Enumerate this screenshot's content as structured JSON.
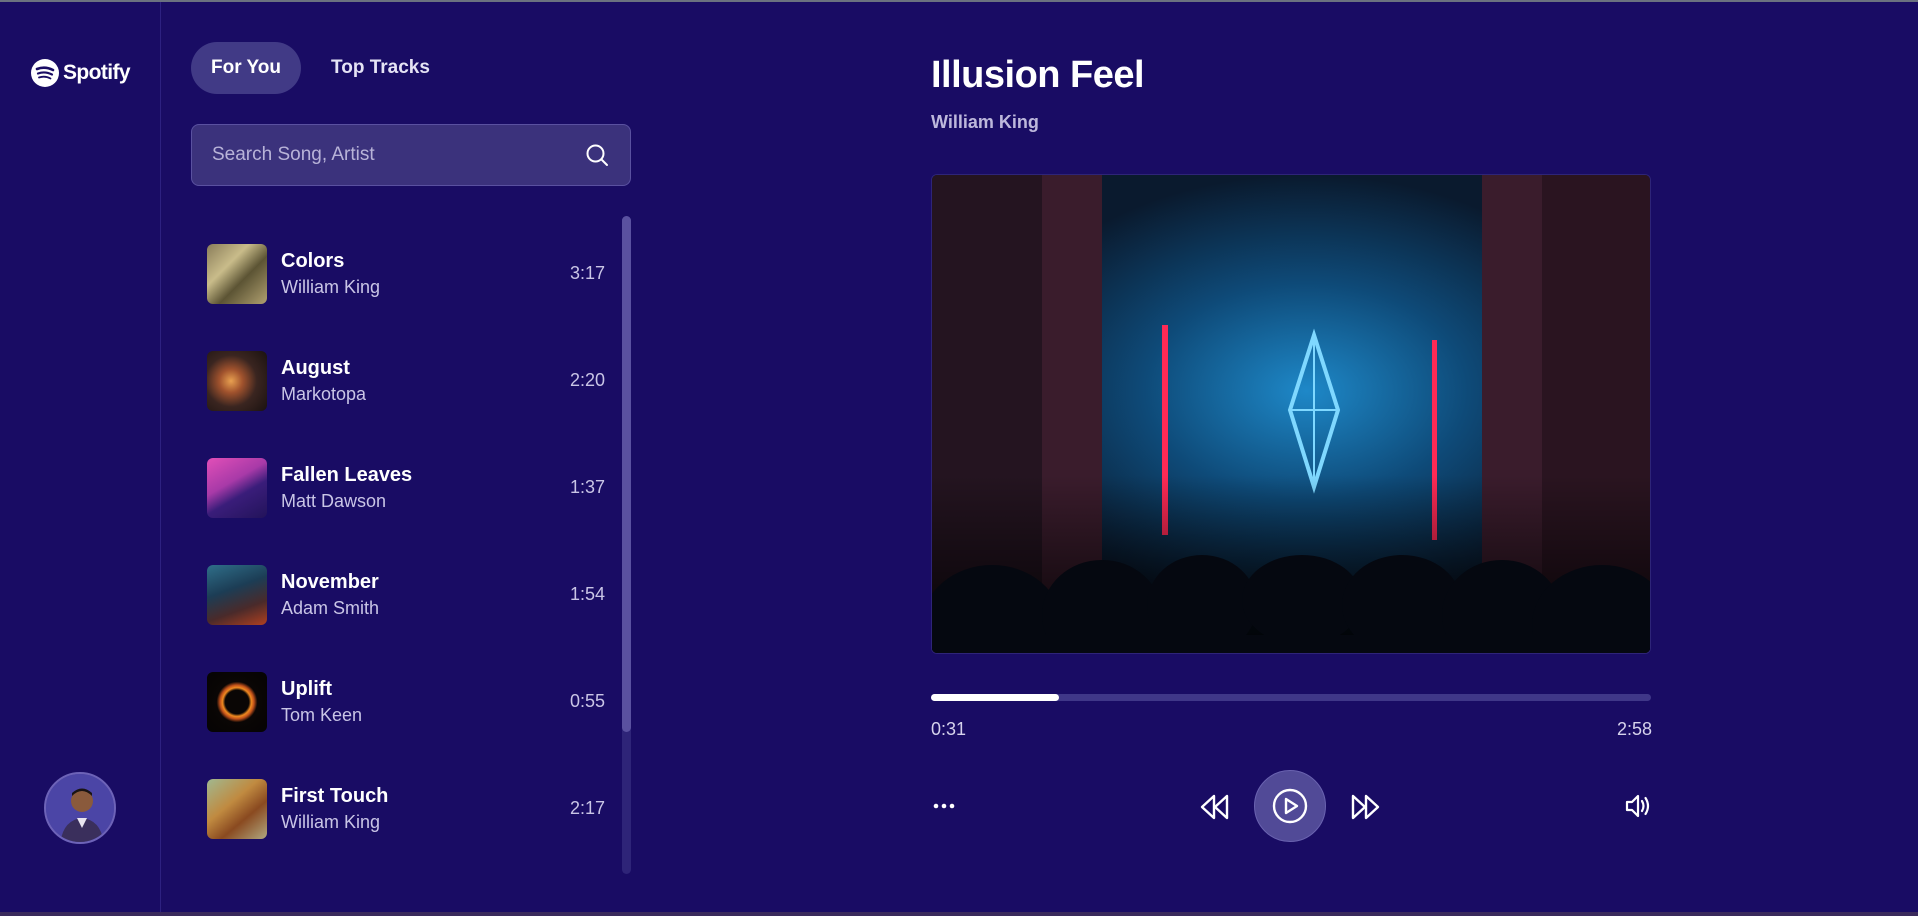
{
  "brand": {
    "name": "Spotify"
  },
  "tabs": [
    {
      "label": "For You",
      "active": true
    },
    {
      "label": "Top Tracks",
      "active": false
    }
  ],
  "search": {
    "placeholder": "Search Song, Artist",
    "value": ""
  },
  "tracks": [
    {
      "title": "Colors",
      "artist": "William King",
      "duration": "3:17"
    },
    {
      "title": "August",
      "artist": "Markotopa",
      "duration": "2:20"
    },
    {
      "title": "Fallen Leaves",
      "artist": "Matt Dawson",
      "duration": "1:37"
    },
    {
      "title": "November",
      "artist": "Adam Smith",
      "duration": "1:54"
    },
    {
      "title": "Uplift",
      "artist": "Tom Keen",
      "duration": "0:55"
    },
    {
      "title": "First Touch",
      "artist": "William King",
      "duration": "2:17"
    }
  ],
  "player": {
    "title": "Illusion Feel",
    "artist": "William King",
    "elapsed": "0:31",
    "total": "2:58",
    "progress": 0.178
  },
  "icons": {
    "logo": "spotify-logo-icon",
    "search": "search-icon",
    "more": "more-horizontal-icon",
    "rewind": "rewind-icon",
    "play": "play-icon",
    "forward": "fast-forward-icon",
    "volume": "volume-icon"
  },
  "colors": {
    "background": "#190c64",
    "accent": "#413a86",
    "progress_track": "#3f3788",
    "progress_fill": "#ffffff"
  }
}
